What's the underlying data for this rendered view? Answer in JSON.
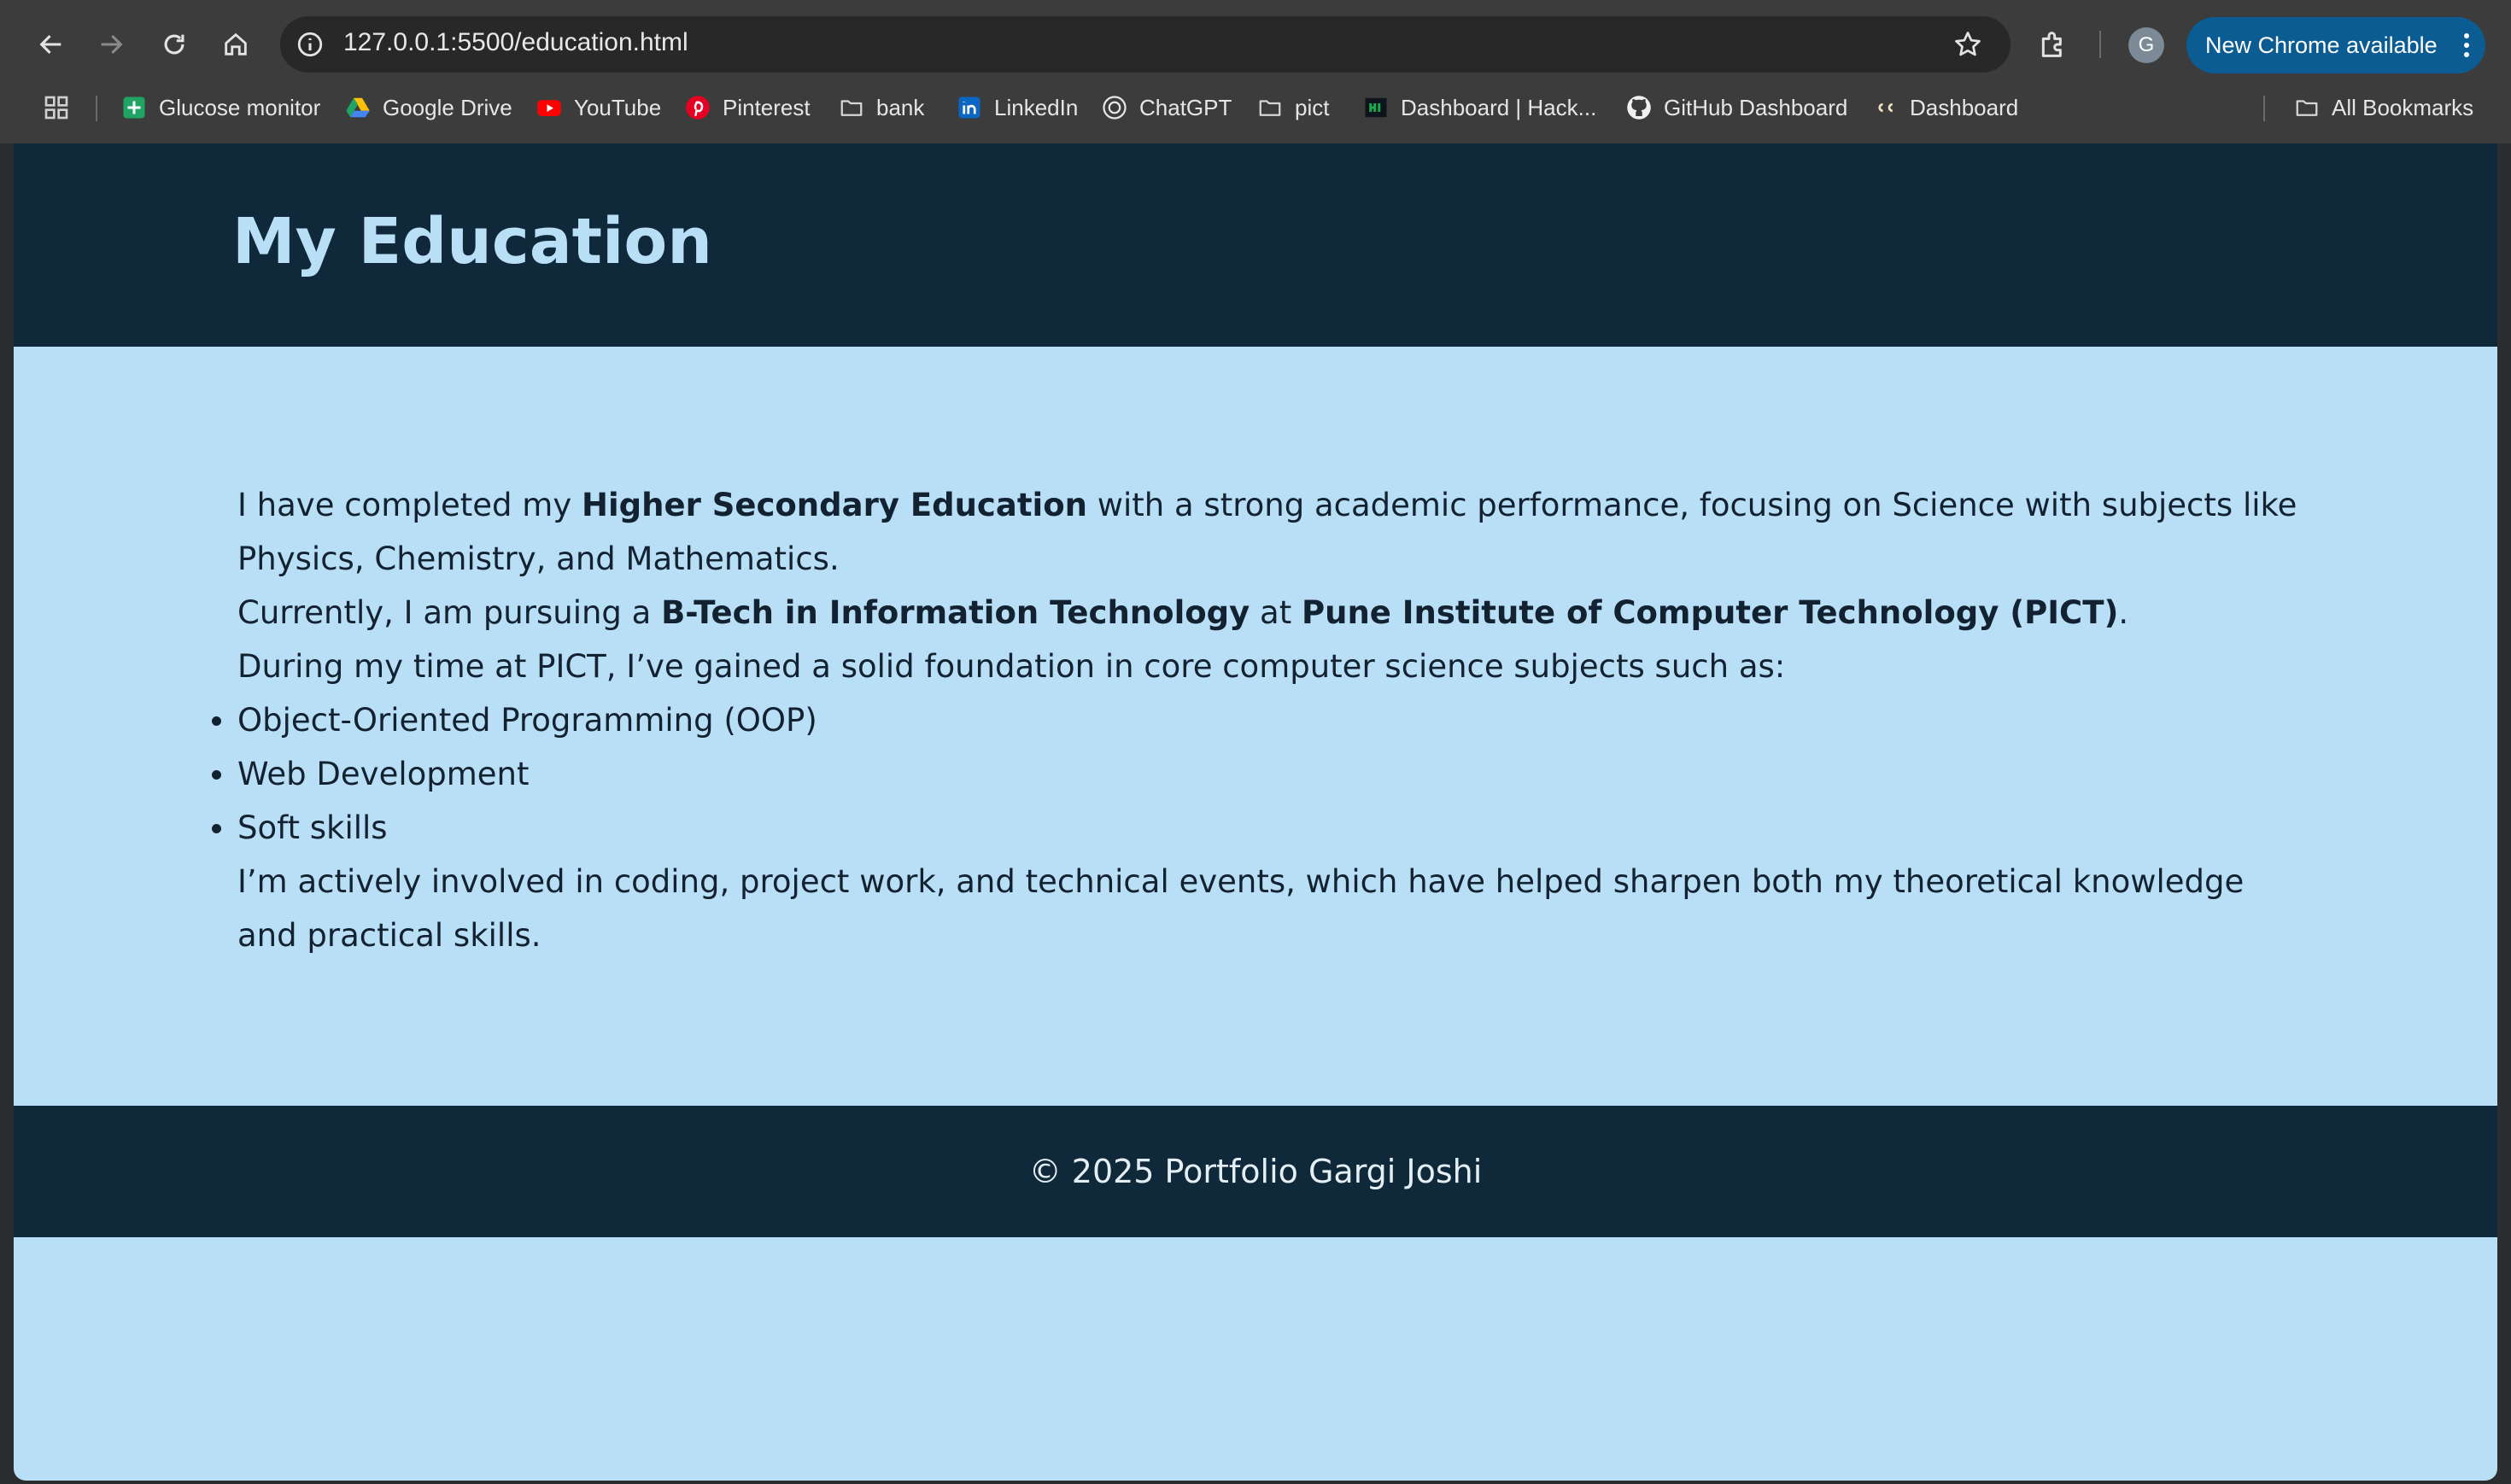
{
  "browser": {
    "url": "127.0.0.1:5500/education.html",
    "profile_initial": "G",
    "update_button_label": "New Chrome available",
    "bookmarks": [
      {
        "label": "Glucose monitor",
        "icon": "sheets-icon"
      },
      {
        "label": "Google Drive",
        "icon": "drive-icon"
      },
      {
        "label": "YouTube",
        "icon": "youtube-icon"
      },
      {
        "label": "Pinterest",
        "icon": "pinterest-icon"
      },
      {
        "label": "bank",
        "icon": "folder-icon"
      },
      {
        "label": "LinkedIn",
        "icon": "linkedin-icon"
      },
      {
        "label": "ChatGPT",
        "icon": "chatgpt-icon"
      },
      {
        "label": "pict",
        "icon": "folder-icon"
      },
      {
        "label": "Dashboard | Hack...",
        "icon": "hackerrank-icon"
      },
      {
        "label": "GitHub Dashboard",
        "icon": "github-icon"
      },
      {
        "label": "Dashboard",
        "icon": "codechef-icon"
      }
    ],
    "all_bookmarks_label": "All Bookmarks"
  },
  "page": {
    "title": "My Education",
    "intro": {
      "part1": "I have completed my ",
      "bold1": "Higher Secondary Education",
      "part2": " with a strong academic performance, focusing on Science with subjects like Physics, Chemistry, and Mathematics."
    },
    "current": {
      "part1": "Currently, I am pursuing a ",
      "bold1": "B-Tech in Information Technology",
      "part2": " at ",
      "bold2": "Pune Institute of Computer Technology (PICT)",
      "part3": "."
    },
    "subjects_intro": "During my time at PICT, I’ve gained a solid foundation in core computer science subjects such as:",
    "subjects": [
      "Object-Oriented Programming (OOP)",
      "Web Development",
      "Soft skills"
    ],
    "closing": "I’m actively involved in coding, project work, and technical events, which have helped sharpen both my theoretical knowledge and practical skills.",
    "footer": "© 2025 Portfolio Gargi Joshi"
  },
  "colors": {
    "chrome_bg": "#3c3c3c",
    "header_bg": "#10293a",
    "page_bg": "#b9dff7",
    "title_color": "#b9dff7",
    "accent": "#0b5c92"
  }
}
